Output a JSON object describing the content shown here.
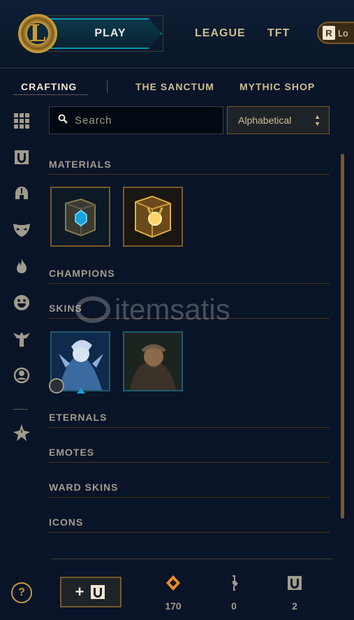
{
  "header": {
    "play_label": "PLAY",
    "nav": [
      "LEAGUE",
      "TFT"
    ],
    "loot_label": "Lo"
  },
  "tabs": [
    {
      "label": "CRAFTING",
      "active": true
    },
    {
      "label": "THE SANCTUM",
      "active": false
    },
    {
      "label": "MYTHIC SHOP",
      "active": false
    }
  ],
  "sidebar": {
    "icons": [
      "grid-icon",
      "chest-icon",
      "helmet-icon",
      "mask-icon",
      "flame-icon",
      "emote-icon",
      "ward-icon",
      "profile-icon",
      "eternals-icon"
    ]
  },
  "search": {
    "placeholder": "Search",
    "value": ""
  },
  "sort": {
    "selected": "Alphabetical"
  },
  "sections": [
    {
      "title": "MATERIALS"
    },
    {
      "title": "CHAMPIONS"
    },
    {
      "title": "SKINS"
    },
    {
      "title": "ETERNALS"
    },
    {
      "title": "EMOTES"
    },
    {
      "title": "WARD SKINS"
    },
    {
      "title": "ICONS"
    }
  ],
  "materials": [
    "hextech-chest",
    "masterwork-chest"
  ],
  "skins": [
    "sorceress-skin",
    "bearded-warrior-skin"
  ],
  "watermark": "itemsatis",
  "footer": {
    "craft_button": "+",
    "currencies": [
      {
        "name": "orange-essence-icon",
        "count": "170"
      },
      {
        "name": "key-icon",
        "count": "0"
      },
      {
        "name": "chest-icon",
        "count": "2"
      }
    ]
  },
  "colors": {
    "background": "#0a1428",
    "gold": "#c89b3c",
    "teal": "#0596aa",
    "orange_essence": "#f08a24"
  }
}
